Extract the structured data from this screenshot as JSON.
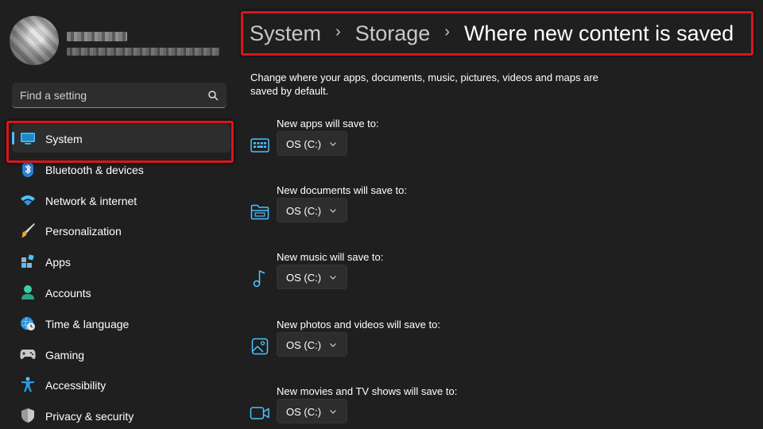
{
  "search": {
    "placeholder": "Find a setting"
  },
  "nav": {
    "items": [
      {
        "label": "System",
        "icon": "monitor-icon",
        "active": true
      },
      {
        "label": "Bluetooth & devices",
        "icon": "bluetooth-icon"
      },
      {
        "label": "Network & internet",
        "icon": "wifi-icon"
      },
      {
        "label": "Personalization",
        "icon": "paintbrush-icon"
      },
      {
        "label": "Apps",
        "icon": "apps-grid-icon"
      },
      {
        "label": "Accounts",
        "icon": "person-icon"
      },
      {
        "label": "Time & language",
        "icon": "globe-clock-icon"
      },
      {
        "label": "Gaming",
        "icon": "gamepad-icon"
      },
      {
        "label": "Accessibility",
        "icon": "accessibility-person-icon"
      },
      {
        "label": "Privacy & security",
        "icon": "shield-icon"
      }
    ]
  },
  "breadcrumb": {
    "items": [
      "System",
      "Storage",
      "Where new content is saved"
    ],
    "separator": "›"
  },
  "description": "Change where your apps, documents, music, pictures, videos and maps are saved by default.",
  "locations": [
    {
      "label": "New apps will save to:",
      "value": "OS (C:)",
      "icon": "apps-keyboard-icon"
    },
    {
      "label": "New documents will save to:",
      "value": "OS (C:)",
      "icon": "folder-icon"
    },
    {
      "label": "New music will save to:",
      "value": "OS (C:)",
      "icon": "music-note-icon"
    },
    {
      "label": "New photos and videos will save to:",
      "value": "OS (C:)",
      "icon": "photo-icon"
    },
    {
      "label": "New movies and TV shows will save to:",
      "value": "OS (C:)",
      "icon": "video-camera-icon"
    }
  ],
  "colors": {
    "accent": "#4cc2ff",
    "highlight_frame": "#d9161c",
    "background": "#1f1f1f",
    "control": "#2d2d2d"
  }
}
